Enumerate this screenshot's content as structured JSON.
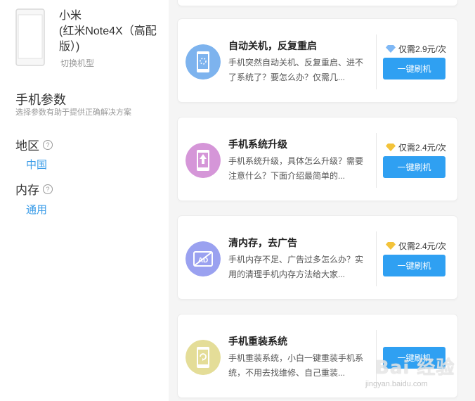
{
  "device": {
    "name": "小米\n(红米Note4X（高配版）)",
    "switch_label": "切换机型"
  },
  "params": {
    "title": "手机参数",
    "subtitle": "选择参数有助于提供正确解决方案",
    "region_label": "地区",
    "region_value": "中国",
    "storage_label": "内存",
    "storage_value": "通用"
  },
  "services": [
    {
      "title": "自动关机，反复重启",
      "desc": "手机突然自动关机、反复重启、进不了系统了？要怎么办？仅需几...",
      "price": "仅需2.9元/次",
      "gem_color": "#7fb8f5",
      "icon_name": "phone-restart-icon",
      "icon_color": "#7db3ee",
      "button": "一键刷机"
    },
    {
      "title": "手机系统升级",
      "desc": "手机系统升级，具体怎么升级？需要注意什么？下面介绍最简单的...",
      "price": "仅需2.4元/次",
      "gem_color": "#f3c33a",
      "icon_name": "phone-upgrade-icon",
      "icon_color": "#d596d8",
      "button": "一键刷机"
    },
    {
      "title": "清内存，去广告",
      "desc": "手机内存不足、广告过多怎么办？实用的清理手机内存方法给大家...",
      "price": "仅需2.4元/次",
      "gem_color": "#f3c33a",
      "icon_name": "ad-block-icon",
      "icon_color": "#9aa1f0",
      "button": "一键刷机"
    },
    {
      "title": "手机重装系统",
      "desc": "手机重装系统，小白一键重装手机系统，不用去找维修、自己重装...",
      "price": "",
      "gem_color": "",
      "icon_name": "phone-reinstall-icon",
      "icon_color": "#e4dd98",
      "button": "一键刷机"
    }
  ],
  "watermark": {
    "text": "Bai 经验",
    "url": "jingyan.baidu.com"
  }
}
